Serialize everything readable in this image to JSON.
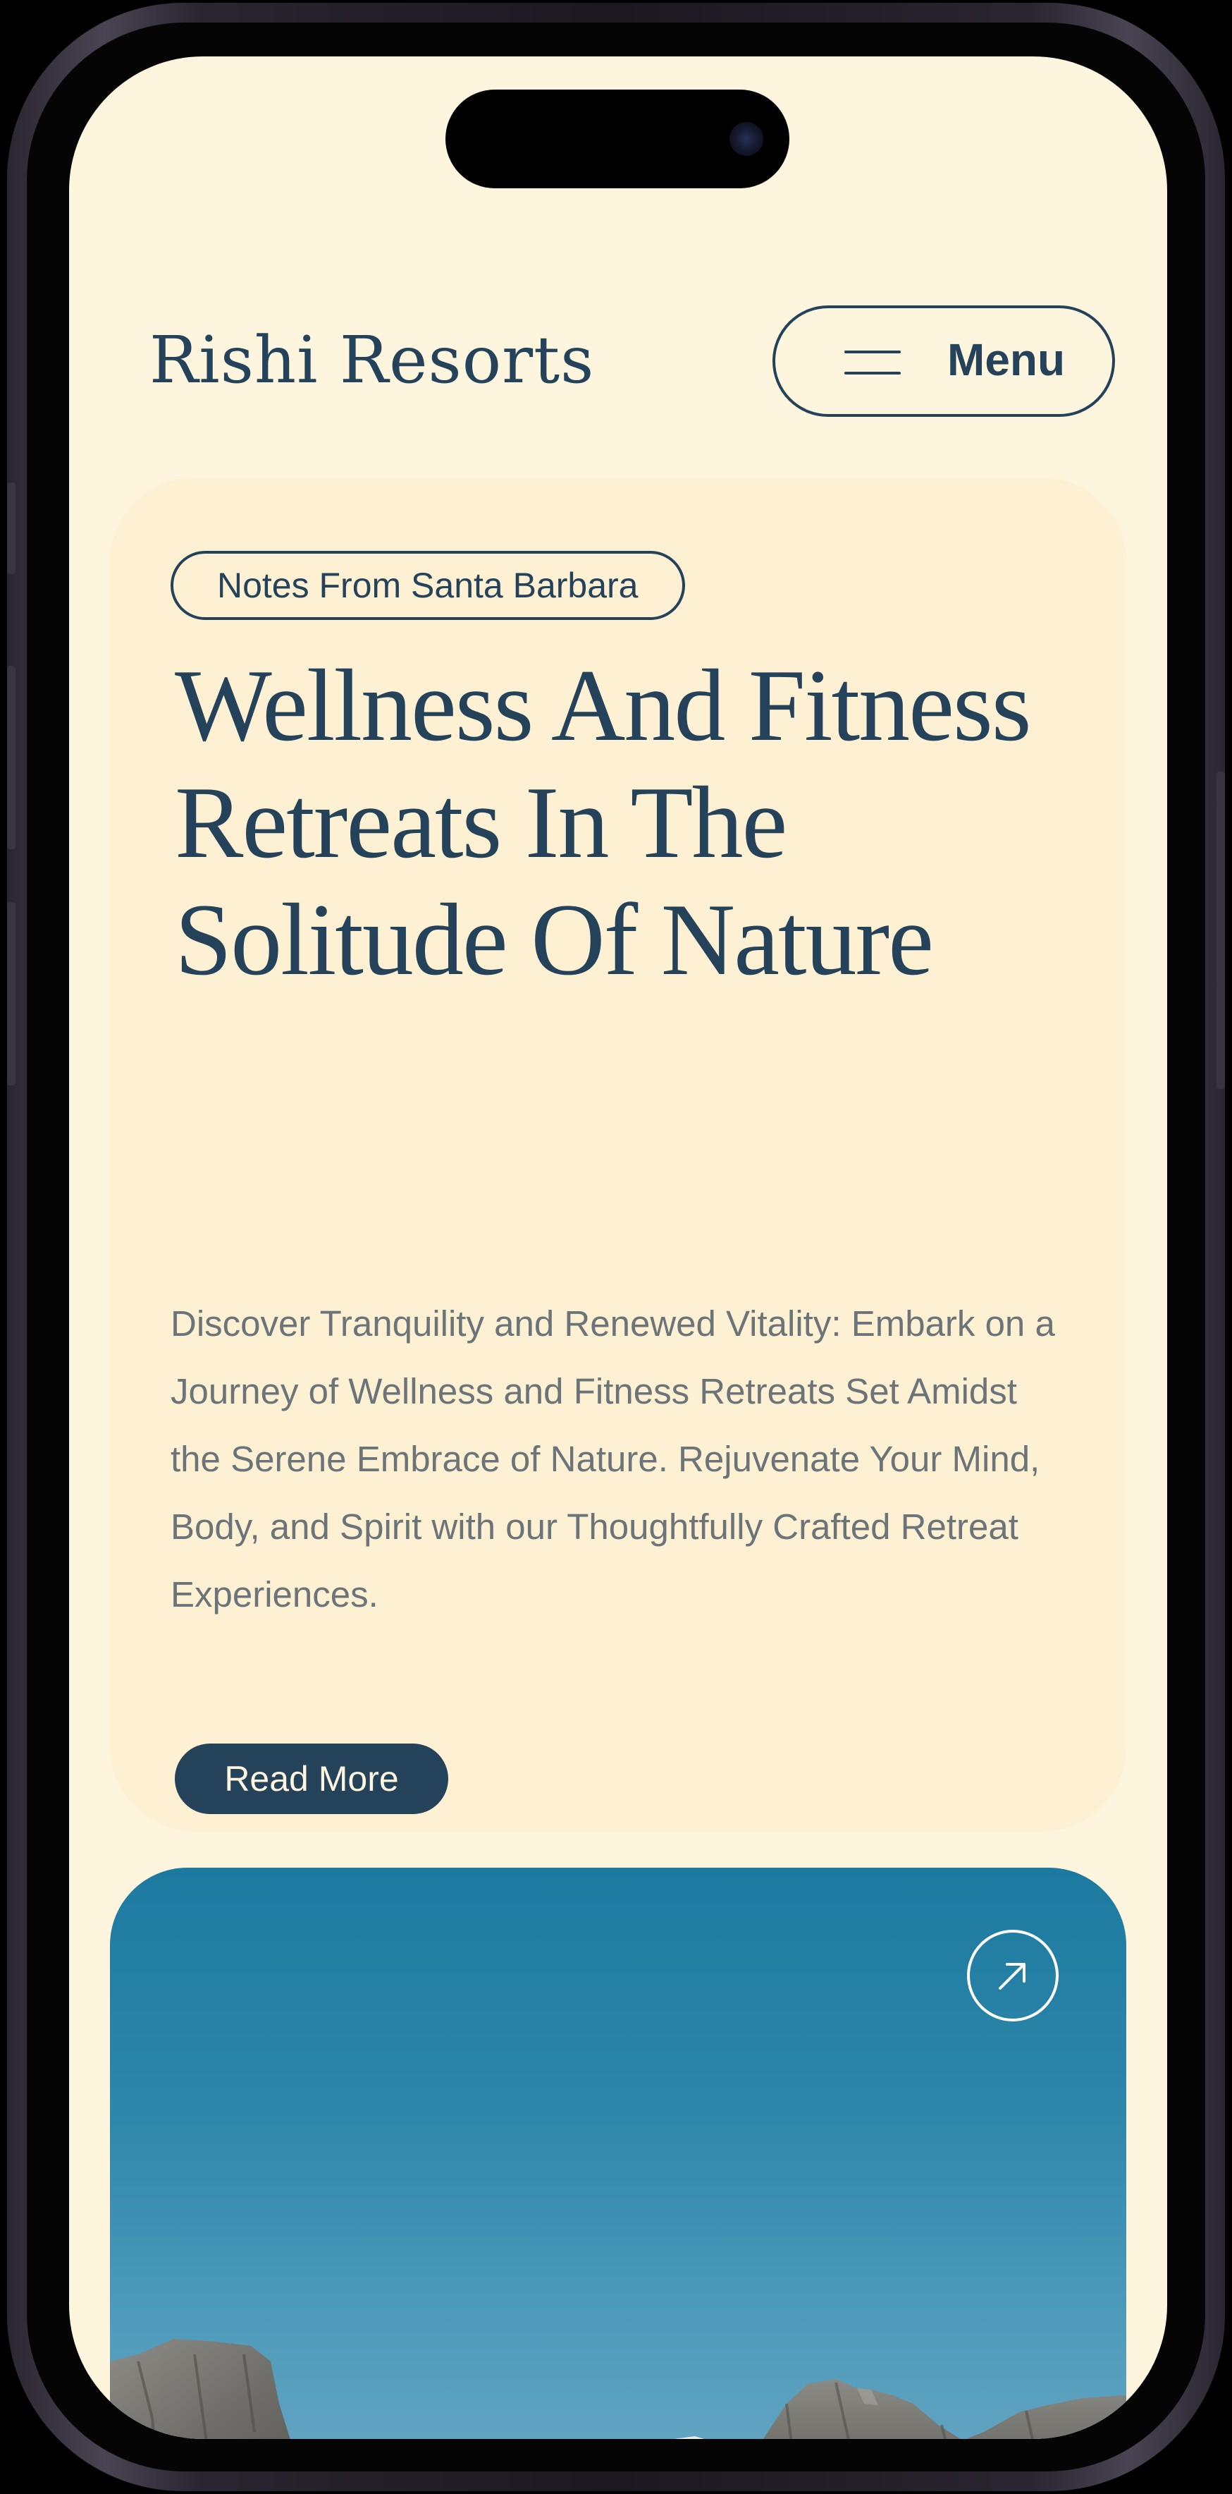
{
  "header": {
    "brand": "Rishi Resorts",
    "menu_label": "Menu",
    "menu_icon": "hamburger-icon"
  },
  "article": {
    "tag": "Notes From Santa Barbara",
    "headline": "Wellness And Fitness Retreats In The Solitude Of Nature",
    "summary": "Discover Tranquility and Renewed Vitality: Embark on a Journey of Wellness and Fitness Retreats Set Amidst the Serene Embrace of Nature. Rejuvenate Your Mind, Body, and Spirit with our Thoughtfully Crafted Retreat Experiences.",
    "read_more_label": "Read More"
  },
  "feature_image": {
    "description_icon": "arrow-up-right-icon"
  },
  "colors": {
    "background": "#fdf5de",
    "card": "#fef0d3",
    "primary": "#24425a",
    "body_text": "#6b7478",
    "sky": "#1c7aa0"
  }
}
